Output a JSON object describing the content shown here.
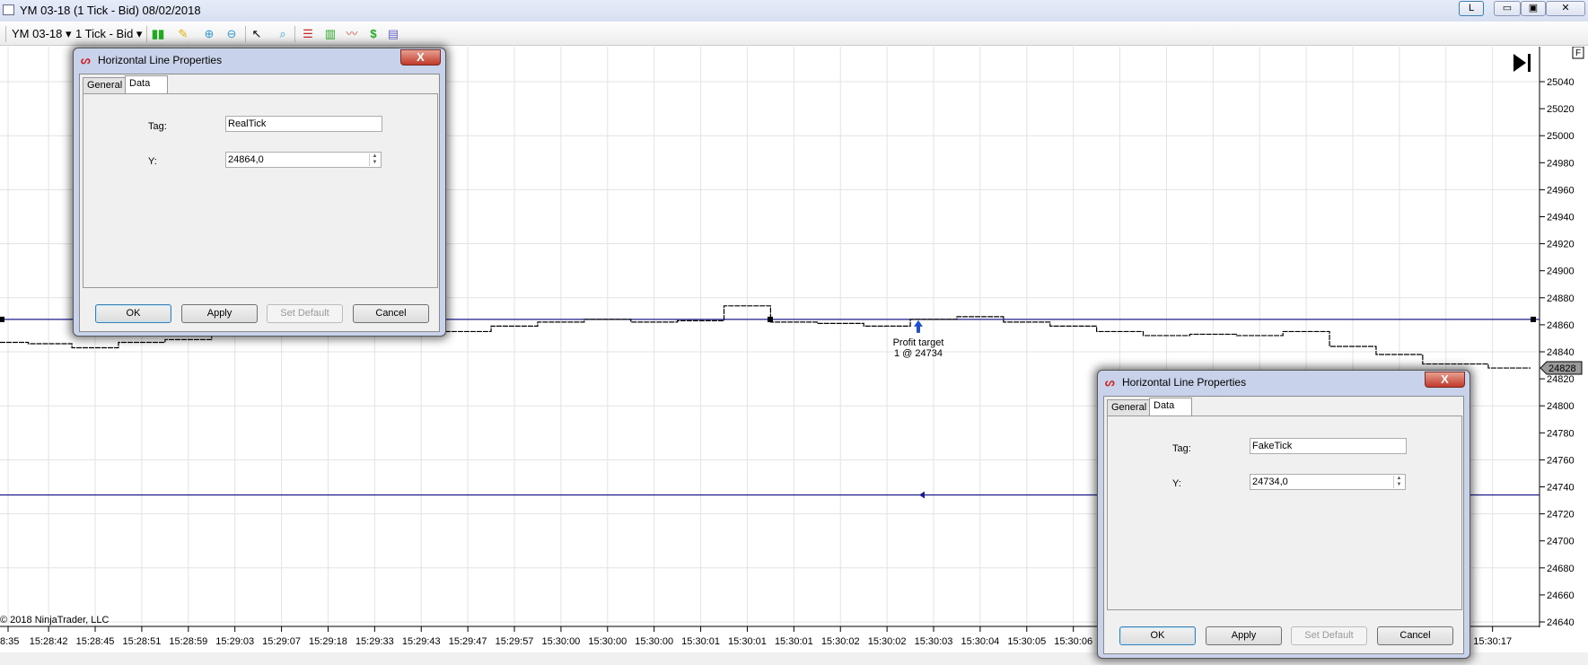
{
  "window": {
    "title": "YM 03-18 (1 Tick - Bid)  08/02/2018",
    "buttons": [
      "L",
      "▭",
      "▣",
      "✕"
    ]
  },
  "toolbar": {
    "instrument": "YM 03-18 ▾",
    "interval": "1 Tick - Bid ▾"
  },
  "colors": {
    "line": "#1a1a8c",
    "price": "#000000",
    "grid": "#e3e3e3",
    "accent": "#1f4fd0"
  },
  "chart_data": {
    "type": "line",
    "y_ticks": [
      25040,
      25020,
      25000,
      24980,
      24960,
      24940,
      24920,
      24900,
      24880,
      24860,
      24840,
      24820,
      24800,
      24780,
      24760,
      24740,
      24720,
      24700,
      24680,
      24660,
      24640
    ],
    "ylim": [
      24640,
      25040
    ],
    "x_ticks": [
      "8:35",
      "15:28:42",
      "15:28:45",
      "15:28:51",
      "15:28:59",
      "15:29:03",
      "15:29:07",
      "15:29:18",
      "15:29:33",
      "15:29:43",
      "15:29:47",
      "15:29:57",
      "15:30:00",
      "15:30:00",
      "15:30:00",
      "15:30:01",
      "15:30:01",
      "15:30:01",
      "15:30:02",
      "15:30:02",
      "15:30:03",
      "15:30:04",
      "15:30:05",
      "15:30:06",
      "",
      "",
      "",
      "",
      "",
      "",
      "",
      "",
      "15:30:17"
    ],
    "price": [
      24847,
      24846,
      24843,
      24847,
      24849,
      24853,
      24855,
      24853,
      24855,
      24853,
      24855,
      24859,
      24862,
      24864,
      24862,
      24863,
      24874,
      24862,
      24861,
      24859,
      24864,
      24866,
      24862,
      24859,
      24855,
      24852,
      24853,
      24852,
      24855,
      24844,
      24838,
      24831,
      24828
    ],
    "last_price": "24828",
    "horizontal_lines": [
      {
        "tag": "RealTick",
        "y": 24864
      },
      {
        "tag": "FakeTick",
        "y": 24734
      }
    ],
    "annotation": {
      "line1": "Profit target",
      "line2": "1 @ 24734"
    },
    "copyright": "© 2018 NinjaTrader, LLC",
    "scale_flag": "F"
  },
  "dialogs": [
    {
      "title": "Horizontal Line Properties",
      "close": "X",
      "tabs": [
        "General",
        "Data"
      ],
      "tag_label": "Tag:",
      "tag_value": "RealTick",
      "y_label": "Y:",
      "y_value": "24864,0",
      "buttons": [
        "OK",
        "Apply",
        "Set Default",
        "Cancel"
      ]
    },
    {
      "title": "Horizontal Line Properties",
      "close": "X",
      "tabs": [
        "General",
        "Data"
      ],
      "tag_label": "Tag:",
      "tag_value": "FakeTick",
      "y_label": "Y:",
      "y_value": "24734,0",
      "buttons": [
        "OK",
        "Apply",
        "Set Default",
        "Cancel"
      ]
    }
  ]
}
